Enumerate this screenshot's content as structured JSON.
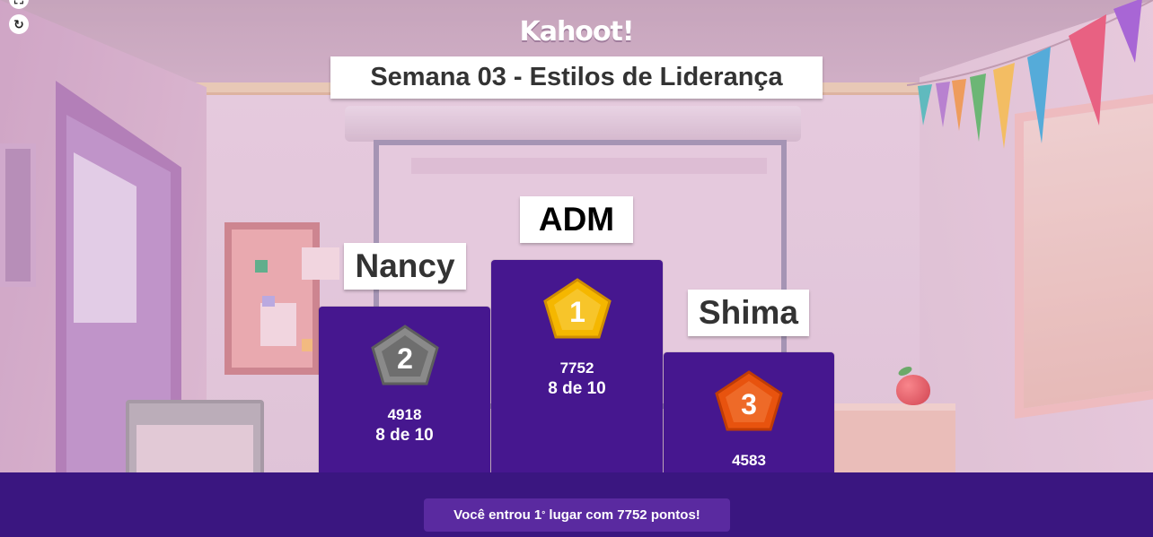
{
  "app": {
    "logo_text": "Kahoot!",
    "quiz_title": "Semana 03 - Estilos de Liderança"
  },
  "controls": {
    "fullscreen_icon": "fullscreen-icon",
    "reload_icon": "reload-icon"
  },
  "podium": {
    "first": {
      "rank": "1",
      "name": "ADM",
      "score": "7752",
      "correct": "8 de 10",
      "medal_color": "#f5b700"
    },
    "second": {
      "rank": "2",
      "name": "Nancy",
      "score": "4918",
      "correct": "8 de 10",
      "medal_color": "#7a7a7a"
    },
    "third": {
      "rank": "3",
      "name": "Shima",
      "score": "4583",
      "medal_color": "#e8530e"
    }
  },
  "result": {
    "prefix": "Você entrou 1",
    "ordinal_mark": "°",
    "suffix": " lugar com 7752 pontos!"
  },
  "colors": {
    "podium_purple": "#46178f",
    "bar_purple": "#3a1680"
  }
}
